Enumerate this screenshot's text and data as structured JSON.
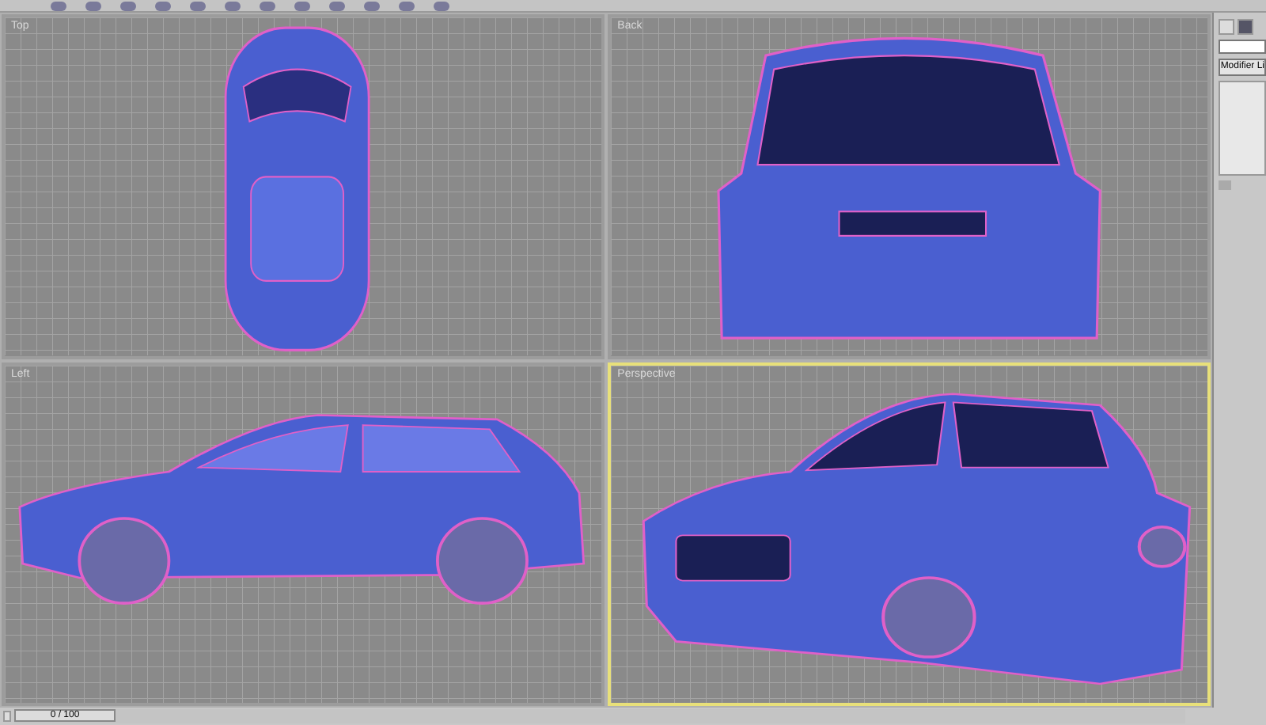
{
  "viewports": [
    {
      "label": "Top",
      "kind": "top",
      "selected": false
    },
    {
      "label": "Back",
      "kind": "back",
      "selected": false
    },
    {
      "label": "Left",
      "kind": "side",
      "selected": false
    },
    {
      "label": "Perspective",
      "kind": "perspective",
      "selected": true
    }
  ],
  "command_panel": {
    "modifier_list": "Modifier Li"
  },
  "time_slider": {
    "frame": "0 / 100",
    "level": 0
  }
}
